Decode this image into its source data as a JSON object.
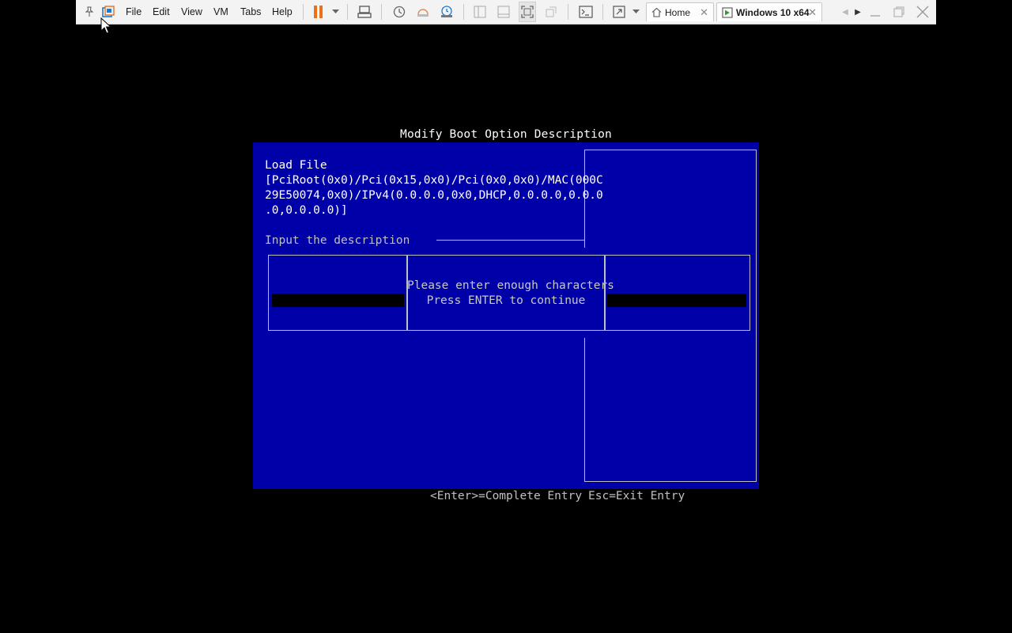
{
  "toolbar": {
    "menus": [
      "File",
      "Edit",
      "View",
      "VM",
      "Tabs",
      "Help"
    ],
    "icons": {
      "pin": "pin-icon",
      "library": "library-icon",
      "pause": "pause-icon",
      "dropdown": "chevron-down-icon",
      "send_ctrl_alt_del": "send-keys-icon",
      "snapshot": "snapshot-icon",
      "revert": "revert-snapshot-icon",
      "snapshot_manager": "snapshot-manager-icon",
      "view_library": "view-library-icon",
      "view_thumbnail": "view-thumbnail-icon",
      "fullscreen": "fullscreen-icon",
      "unity": "unity-icon",
      "console": "console-icon",
      "stretch": "stretch-icon"
    },
    "colors": {
      "pause": "#e8711a",
      "accent": "#1b7bd0"
    }
  },
  "tabs": [
    {
      "label": "Home",
      "icon": "home-icon",
      "active": false
    },
    {
      "label": "Windows 10 x64",
      "icon": "vm-icon",
      "active": true
    }
  ],
  "bios": {
    "title": "Modify Boot Option Description",
    "load_file_label": "Load File",
    "device_path_lines": [
      "[PciRoot(0x0)/Pci(0x15,0x0)/Pci(0x0,0x0)/MAC(000C",
      "29E50074,0x0)/IPv4(0.0.0.0,0x0,DHCP,0.0.0.0,0.0.0",
      ".0,0.0.0.0)]"
    ],
    "input_label": "Input the description",
    "dialog": {
      "line1": "Please enter enough characters",
      "line2": "Press ENTER to continue"
    },
    "hint_enter": "<Enter>=Complete Entry",
    "hint_esc": "Esc=Exit Entry",
    "colors": {
      "background": "#0000a8",
      "text": "#ffffff",
      "dim_text": "#c0c0c0"
    }
  }
}
